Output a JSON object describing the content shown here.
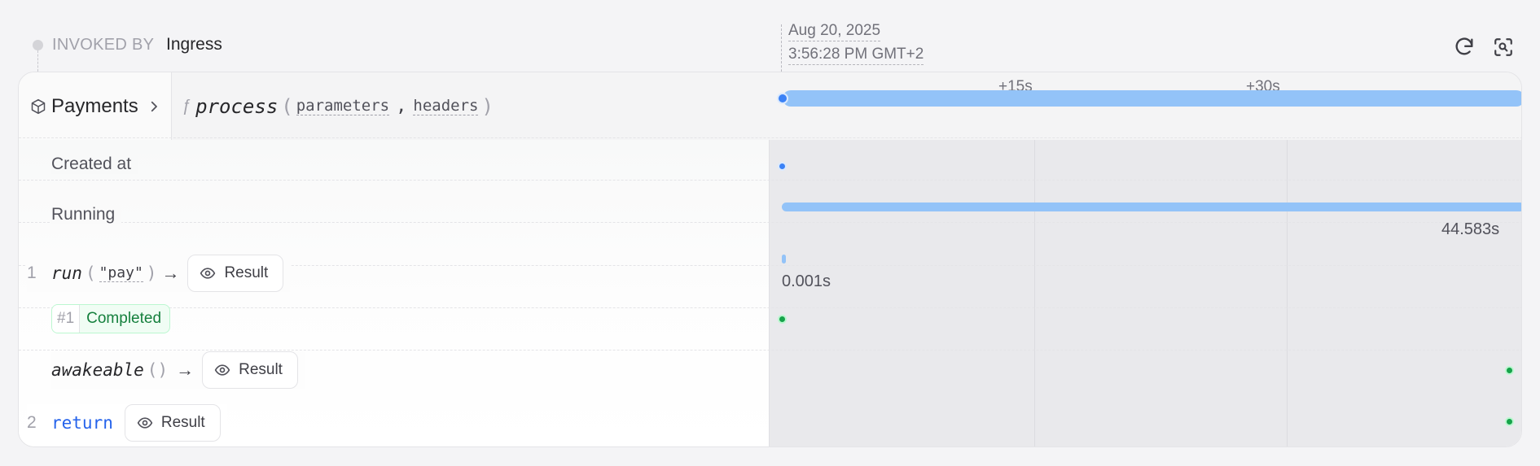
{
  "invoked_by": {
    "label": "INVOKED BY",
    "value": "Ingress"
  },
  "timestamp": {
    "date": "Aug 20, 2025",
    "time": "3:56:28 PM GMT+2"
  },
  "toolbar": {
    "refresh_icon": "refresh-icon",
    "zoom_icon": "zoom-search-icon"
  },
  "header": {
    "service": "Payments",
    "handler_prefix": "ƒ",
    "handler": "process",
    "open_paren": "(",
    "params": [
      "parameters",
      "headers"
    ],
    "comma": ",",
    "close_paren": ")",
    "ticks": [
      "+15s",
      "+30s"
    ]
  },
  "rows": {
    "created": {
      "label": "Created at"
    },
    "running": {
      "label": "Running",
      "duration": "44.583s"
    },
    "run": {
      "line": "1",
      "fn": "run",
      "open": "(",
      "arg": "\"pay\"",
      "close": ")",
      "arrow": "→",
      "result": "Result",
      "duration": "0.001s"
    },
    "attempt": {
      "num": "#1",
      "status": "Completed"
    },
    "awakeable": {
      "fn": "awakeable",
      "parens": "()",
      "arrow": "→",
      "result": "Result"
    },
    "ret": {
      "line": "2",
      "keyword": "return",
      "result": "Result"
    }
  },
  "colors": {
    "accent": "#93c3f8",
    "blue": "#3b82f6",
    "green": "#16a34a",
    "return_keyword": "#2563eb"
  }
}
